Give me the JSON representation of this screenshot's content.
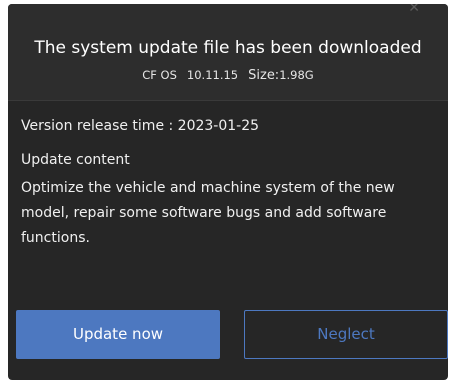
{
  "dialog": {
    "title": "The system update file has been downloaded",
    "os_name": "CF OS",
    "version": "10.11.15",
    "size_label": "Size:",
    "size_value": "1.98G",
    "release_time": "Version release time : 2023-01-25",
    "content_heading": "Update content",
    "content_text": "Optimize the vehicle and machine system of the new model, repair some software bugs and add software functions.",
    "primary_button": "Update now",
    "secondary_button": "Neglect"
  },
  "colors": {
    "dialog_bg": "#262626",
    "header_bg": "#2d2d2d",
    "accent": "#4d78c0",
    "text": "#f0f0f0"
  }
}
